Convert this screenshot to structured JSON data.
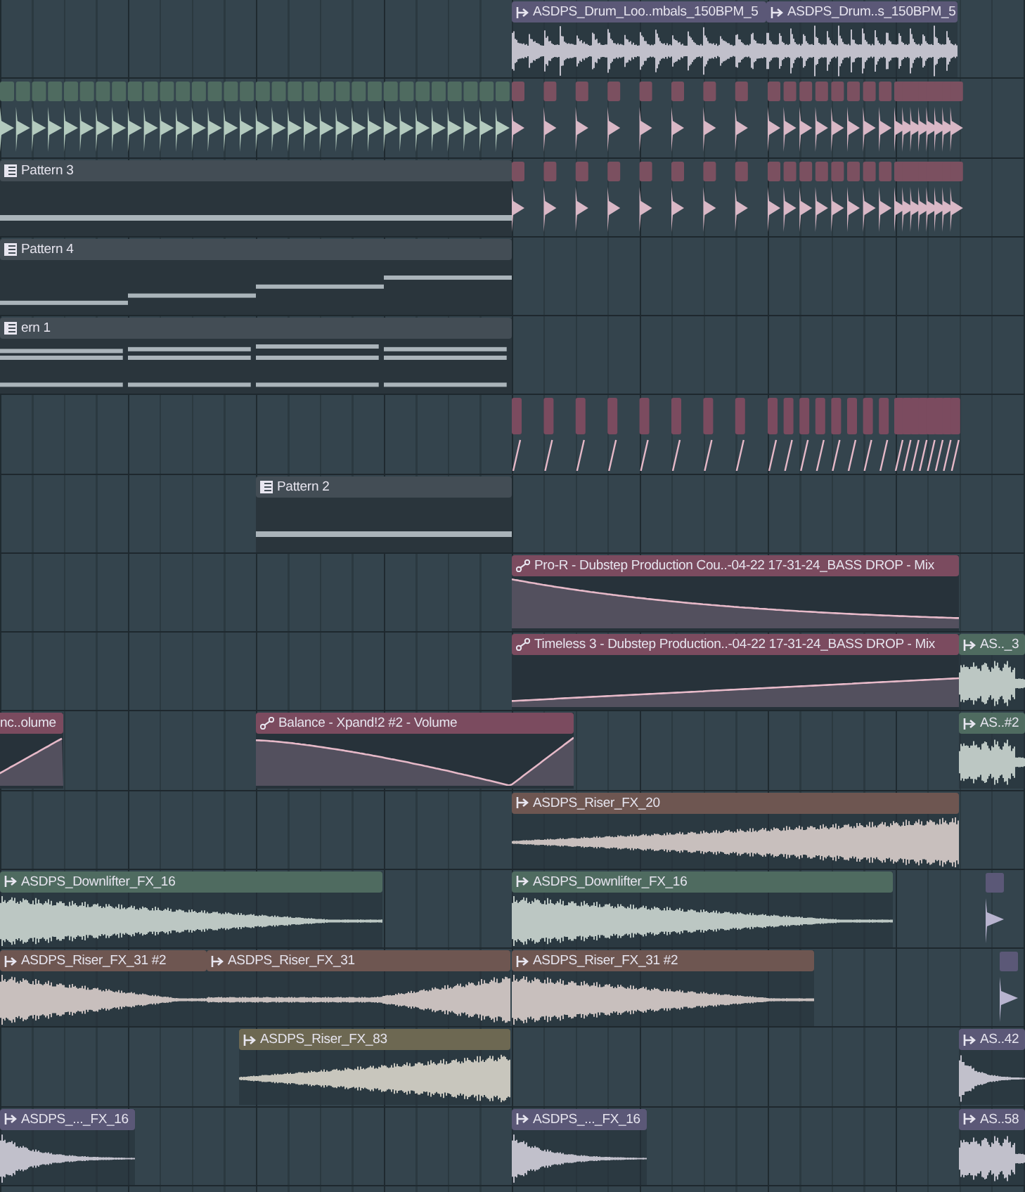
{
  "clips": [
    {
      "kind": "audio",
      "label": "ASDPS_Drum_Loo..mbals_150BPM_5",
      "color": "#5b5877"
    },
    {
      "kind": "audio",
      "label": "ASDPS_Drum..s_150BPM_5",
      "color": "#5b5877"
    },
    {
      "kind": "pattern",
      "label": "Pattern 3",
      "color": "#434d55"
    },
    {
      "kind": "pattern",
      "label": "Pattern 4",
      "color": "#434d55"
    },
    {
      "kind": "pattern",
      "label": "ern 1",
      "color": "#434d55"
    },
    {
      "kind": "pattern",
      "label": "Pattern 2",
      "color": "#434d55"
    },
    {
      "kind": "automation",
      "label": "Pro-R - Dubstep Production Cou..-04-22 17-31-24_BASS DROP - Mix",
      "color": "#7b4b5f"
    },
    {
      "kind": "automation",
      "label": "Timeless 3 - Dubstep Production..-04-22 17-31-24_BASS DROP - Mix",
      "color": "#7b4b5f"
    },
    {
      "kind": "audio",
      "label": "AS.._3",
      "color": "#4f6b60"
    },
    {
      "kind": "automation",
      "label": "nc..olume",
      "color": "#7b4b5f"
    },
    {
      "kind": "automation",
      "label": "Balance - Xpand!2 #2 - Volume",
      "color": "#7b4b5f"
    },
    {
      "kind": "audio",
      "label": "AS..#2",
      "color": "#4f6b60"
    },
    {
      "kind": "audio",
      "label": "ASDPS_Riser_FX_20",
      "color": "#6e5651"
    },
    {
      "kind": "audio",
      "label": "ASDPS_Downlifter_FX_16",
      "color": "#4f6b60"
    },
    {
      "kind": "audio",
      "label": "ASDPS_Downlifter_FX_16",
      "color": "#4f6b60"
    },
    {
      "kind": "audio",
      "label": "ASDPS_Riser_FX_31 #2",
      "color": "#6e5651"
    },
    {
      "kind": "audio",
      "label": "ASDPS_Riser_FX_31",
      "color": "#6e5651"
    },
    {
      "kind": "audio",
      "label": "ASDPS_Riser_FX_31 #2",
      "color": "#6e5651"
    },
    {
      "kind": "audio",
      "label": "ASDPS_Riser_FX_83",
      "color": "#6d6852"
    },
    {
      "kind": "audio",
      "label": "AS..42",
      "color": "#5b5877"
    },
    {
      "kind": "audio",
      "label": "ASDPS_..._FX_16",
      "color": "#5b5877"
    },
    {
      "kind": "audio",
      "label": "ASDPS_..._FX_16",
      "color": "#5b5877"
    },
    {
      "kind": "audio",
      "label": "AS..58",
      "color": "#5b5877"
    }
  ]
}
